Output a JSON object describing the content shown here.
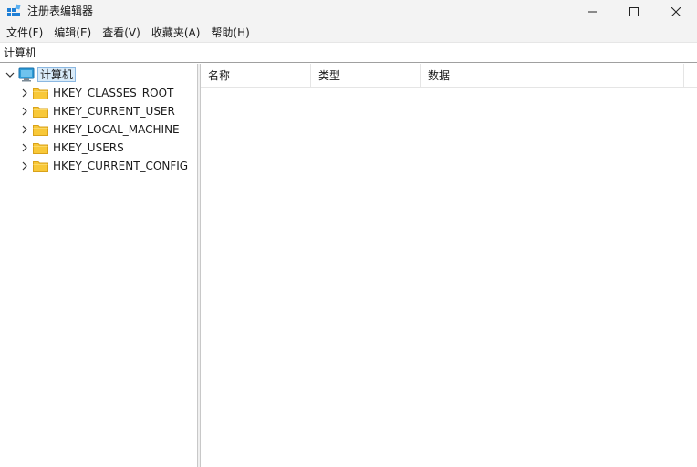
{
  "window": {
    "title": "注册表编辑器",
    "controls": [
      "minimize-icon",
      "maximize-icon",
      "close-icon"
    ]
  },
  "menu": [
    "文件(F)",
    "编辑(E)",
    "查看(V)",
    "收藏夹(A)",
    "帮助(H)"
  ],
  "address": "计算机",
  "tree": {
    "root": {
      "label": "计算机",
      "expanded": true,
      "selected": true,
      "icon": "computer-icon"
    },
    "children": [
      {
        "label": "HKEY_CLASSES_ROOT",
        "icon": "folder-icon"
      },
      {
        "label": "HKEY_CURRENT_USER",
        "icon": "folder-icon"
      },
      {
        "label": "HKEY_LOCAL_MACHINE",
        "icon": "folder-icon"
      },
      {
        "label": "HKEY_USERS",
        "icon": "folder-icon"
      },
      {
        "label": "HKEY_CURRENT_CONFIG",
        "icon": "folder-icon"
      }
    ]
  },
  "list": {
    "columns": [
      "名称",
      "类型",
      "数据"
    ]
  },
  "colors": {
    "folder": "#f8c838",
    "selection": "#d9ebf9",
    "titlebar": "#f3f3f3"
  }
}
